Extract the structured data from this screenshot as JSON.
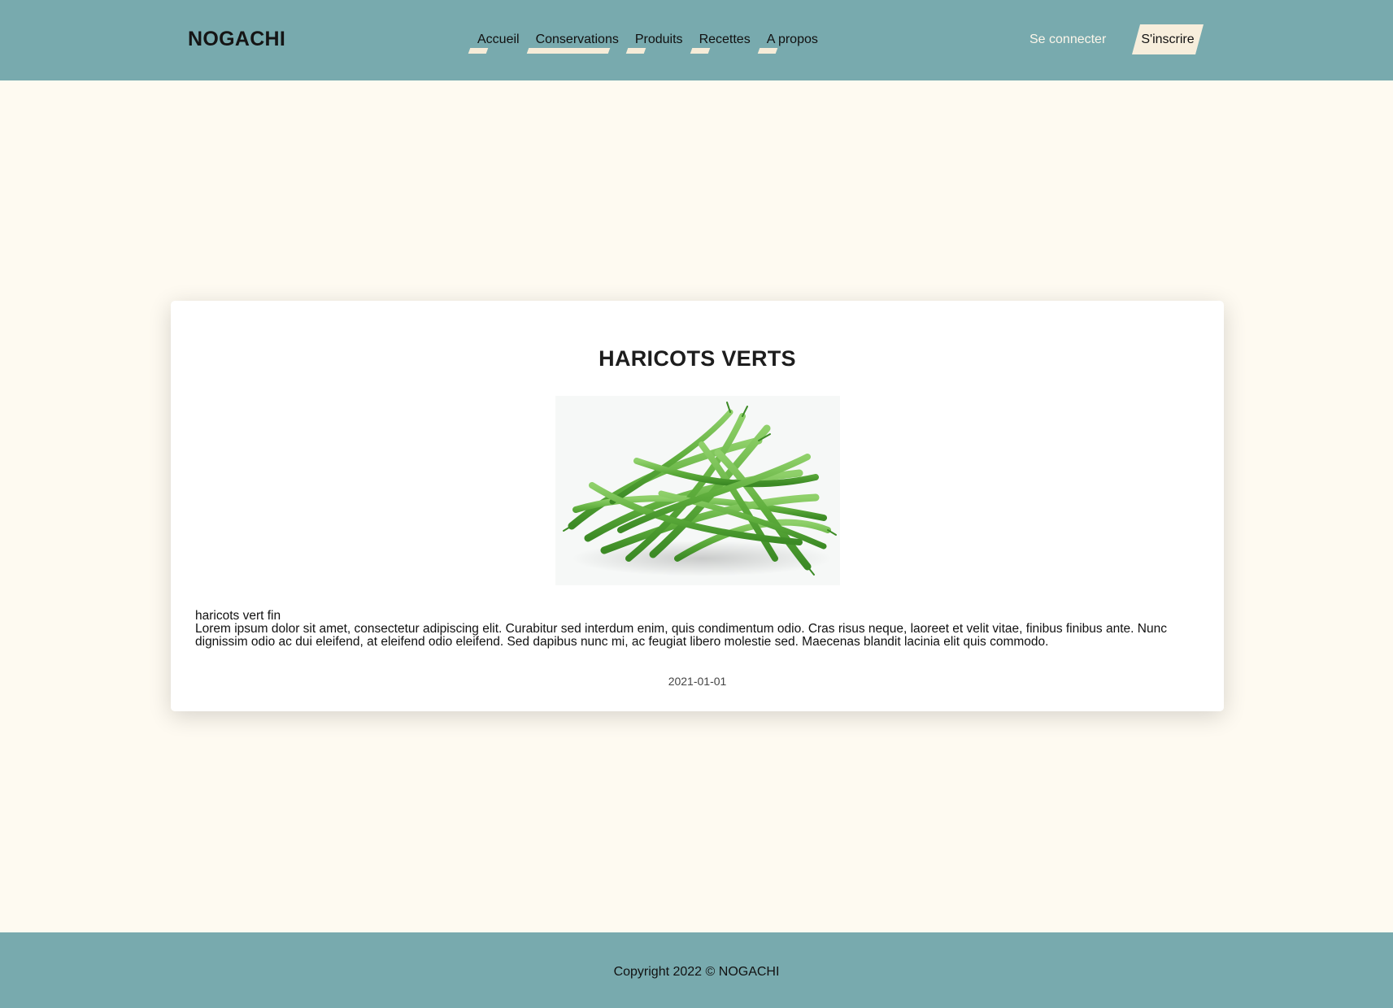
{
  "header": {
    "logo": "NOGACHI",
    "nav": [
      {
        "label": "Accueil"
      },
      {
        "label": "Conservations"
      },
      {
        "label": "Produits"
      },
      {
        "label": "Recettes"
      },
      {
        "label": "A propos"
      }
    ],
    "login_label": "Se connecter",
    "signup_label": "S'inscrire"
  },
  "product": {
    "title": "HARICOTS VERTS",
    "subtitle": "haricots vert fin",
    "description": "Lorem ipsum dolor sit amet, consectetur adipiscing elit. Curabitur sed interdum enim, quis condimentum odio. Cras risus neque, laoreet et velit vitae, finibus finibus ante. Nunc dignissim odio ac dui eleifend, at eleifend odio eleifend. Sed dapibus nunc mi, ac feugiat libero molestie sed. Maecenas blandit lacinia elit quis commodo.",
    "date": "2021-01-01"
  },
  "footer": {
    "copyright": "Copyright 2022 © NOGACHI"
  },
  "colors": {
    "header_bg": "#78aaae",
    "page_bg": "#fefaf1",
    "highlight": "#f6ecd8"
  }
}
